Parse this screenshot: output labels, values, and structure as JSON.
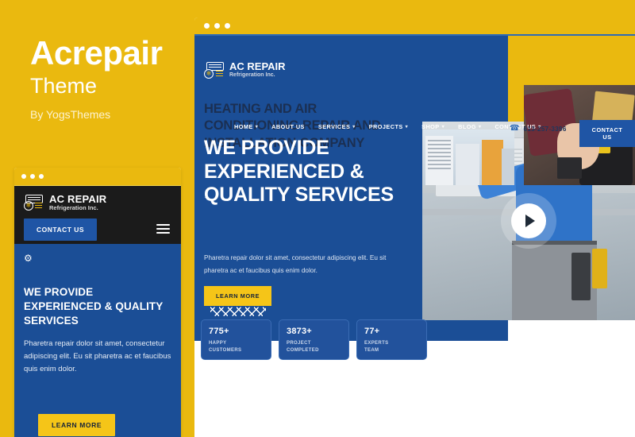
{
  "branding": {
    "title": "Acrepair",
    "subtitle": "Theme",
    "author": "By YogsThemes",
    "accent_yellow": "#eab90f",
    "accent_blue": "#1b4e96"
  },
  "mobile_preview": {
    "window_dots": [
      "dot",
      "dot",
      "dot"
    ],
    "logo": {
      "name": "AC REPAIR",
      "tagline": "Refrigeration Inc."
    },
    "contact_button": "CONTACT US",
    "menu_icon": "hamburger-icon",
    "gear_icon": "gear-icon",
    "hero_title": "WE PROVIDE EXPERIENCED & QUALITY SERVICES",
    "hero_text": "Pharetra repair dolor sit amet, consectetur adipiscing elit. Eu sit pharetra ac et faucibus quis enim dolor.",
    "learn_more": "LEARN MORE"
  },
  "desktop_preview": {
    "window_dots": [
      "dot",
      "dot",
      "dot"
    ],
    "logo": {
      "name": "AC REPAIR",
      "tagline": "Refrigeration Inc."
    },
    "nav_items": [
      {
        "label": "HOME",
        "has_dropdown": true,
        "caret": "▾"
      },
      {
        "label": "ABOUT US",
        "has_dropdown": false,
        "caret": ""
      },
      {
        "label": "SERVICES",
        "has_dropdown": true,
        "caret": "▾"
      },
      {
        "label": "PROJECTS",
        "has_dropdown": true,
        "caret": "▾"
      },
      {
        "label": "SHOP",
        "has_dropdown": true,
        "caret": "▾"
      },
      {
        "label": "BLOG",
        "has_dropdown": true,
        "caret": "▾"
      },
      {
        "label": "CONTACT US",
        "has_dropdown": true,
        "caret": "▾"
      }
    ],
    "phone": {
      "icon": "phone-icon",
      "number": "613-257-3396"
    },
    "cta_button": "CONTACT US",
    "hero_title": "WE PROVIDE EXPERIENCED & QUALITY SERVICES",
    "hero_text": "Pharetra repair dolor sit amet, consectetur adipiscing elit. Eu sit pharetra ac et faucibus quis enim dolor.",
    "learn_more": "LEARN MORE",
    "play_button": "play-icon",
    "stats": [
      {
        "number": "775+",
        "label": "HAPPY\nCUSTOMERS"
      },
      {
        "number": "3873+",
        "label": "PROJECT\nCOMPLETED"
      },
      {
        "number": "77+",
        "label": "EXPERTS\nTEAM"
      }
    ],
    "lower_heading": "HEATING AND AIR CONDITIONING REPAIR AND INSTALLATION COMPANY",
    "lower_images": [
      "building-ac-units-photo",
      "technician-tool-belt-photo"
    ]
  }
}
